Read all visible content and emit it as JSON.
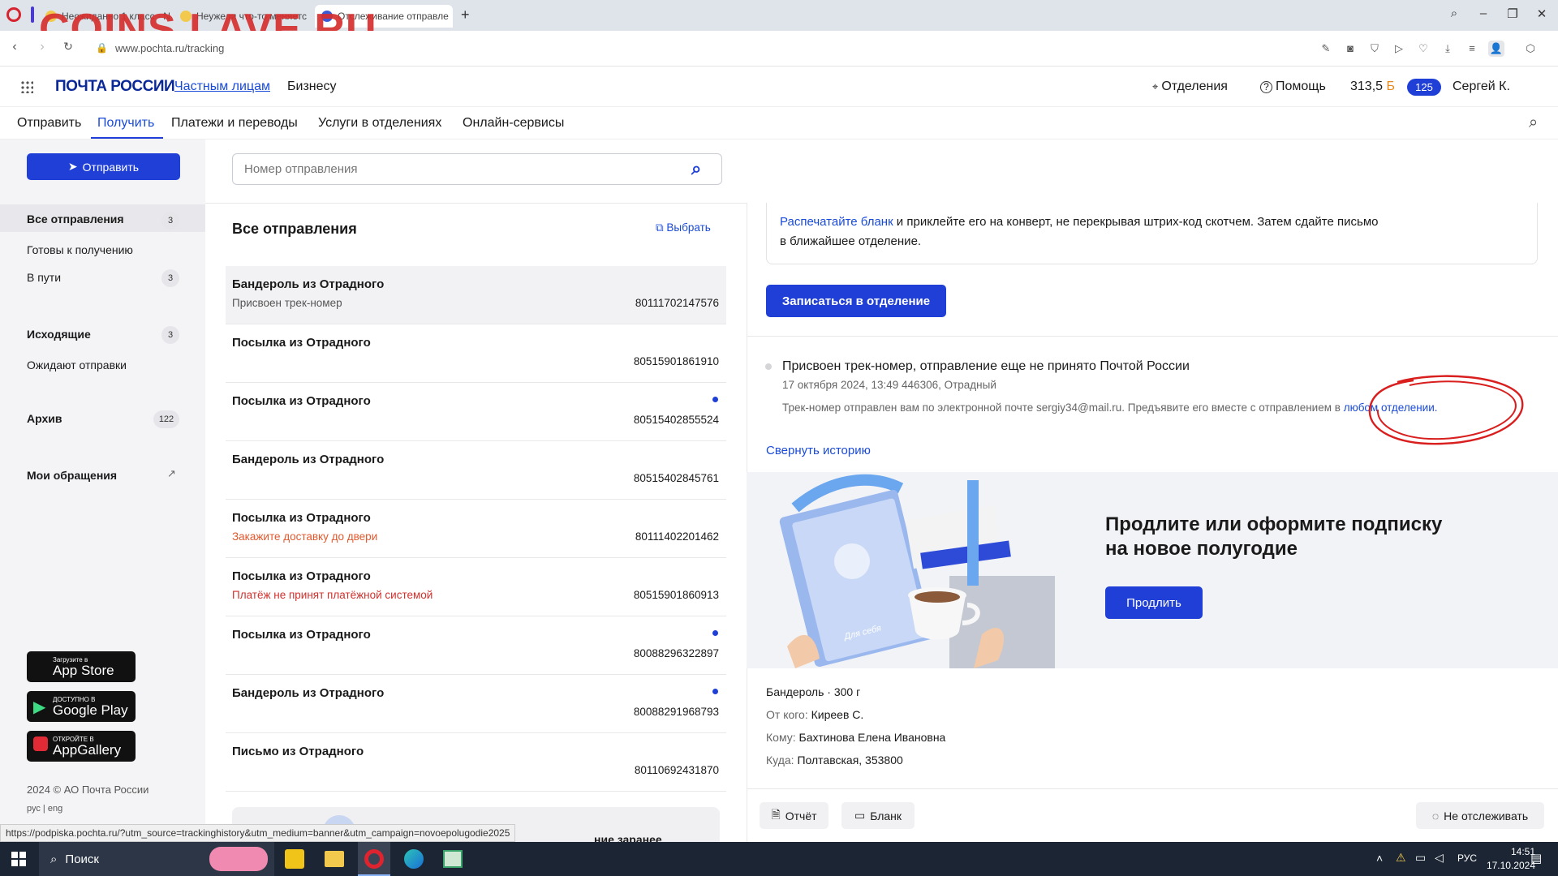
{
  "browser": {
    "tabs": [
      {
        "label": "Неожиданно 1 класс - N"
      },
      {
        "label": "Неужели что-то меняетс"
      },
      {
        "label": "Отслеживание отправле"
      }
    ],
    "url": "www.pochta.ru/tracking",
    "watermark": "COINS.LAVE.RU"
  },
  "header": {
    "logo": "ПОЧТА РОССИИ",
    "nav": [
      "Частным лицам",
      "Бизнесу"
    ],
    "offices": "Отделения",
    "help": "Помощь",
    "bonus": "313,5",
    "bonus_unit": "Б",
    "badge": "125",
    "user": "Сергей К."
  },
  "subnav": [
    "Отправить",
    "Получить",
    "Платежи и переводы",
    "Услуги в отделениях",
    "Онлайн-сервисы"
  ],
  "sidebar": {
    "send_button": "Отправить",
    "items": [
      {
        "label": "Все отправления",
        "count": "3"
      },
      {
        "label": "Готовы к получению",
        "count": ""
      },
      {
        "label": "В пути",
        "count": "3"
      },
      {
        "label": "Исходящие",
        "count": "3"
      },
      {
        "label": "Ожидают отправки",
        "count": ""
      },
      {
        "label": "Архив",
        "count": "122"
      },
      {
        "label": "Мои обращения",
        "count": ""
      }
    ],
    "stores": [
      {
        "small": "Загрузите в",
        "big": "App Store"
      },
      {
        "small": "ДОСТУПНО В",
        "big": "Google Play"
      },
      {
        "small": "ОТКРОЙТЕ В",
        "big": "AppGallery"
      }
    ],
    "copyright": "2024 © АО Почта России",
    "langs": "рус | eng"
  },
  "search": {
    "placeholder": "Номер отправления"
  },
  "list": {
    "title": "Все отправления",
    "select": "Выбрать",
    "items": [
      {
        "title": "Бандероль из Отрадного",
        "sub": "Присвоен трек-номер",
        "number": "80111702147576"
      },
      {
        "title": "Посылка из Отрадного",
        "sub": "",
        "number": "80515901861910"
      },
      {
        "title": "Посылка из Отрадного",
        "sub": "",
        "number": "80515402855524"
      },
      {
        "title": "Бандероль из Отрадного",
        "sub": "",
        "number": "80515402845761"
      },
      {
        "title": "Посылка из Отрадного",
        "sub": "Закажите доставку до двери",
        "number": "80111402201462"
      },
      {
        "title": "Посылка из Отрадного",
        "sub": "Платёж не принят платёжной системой",
        "number": "80515901860913"
      },
      {
        "title": "Посылка из Отрадного",
        "sub": "",
        "number": "80088296322897"
      },
      {
        "title": "Бандероль из Отрадного",
        "sub": "",
        "number": "80088291968793"
      },
      {
        "title": "Письмо из Отрадного",
        "sub": "",
        "number": "80110692431870"
      }
    ],
    "bottom_text": "ние заранее"
  },
  "detail": {
    "print_link": "Распечатайте бланк",
    "print_text": " и приклейте его на конверт, не перекрывая штрих-код скотчем. Затем сдайте письмо",
    "print_text2": "в ближайшее отделение.",
    "appointment_button": "Записаться в отделение",
    "event_title": "Присвоен трек-номер, отправление еще не принято Почтой России",
    "event_meta": "17 октября 2024, 13:49 446306, Отрадный",
    "event_desc": "Трек-номер отправлен вам по электронной почте sergiy34@mail.ru. Предъявите его вместе с отправлением в ",
    "event_link": "любом отделении.",
    "collapse": "Свернуть историю",
    "promo_title1": "Продлите или оформите подписку",
    "promo_title2": "на новое полугодие",
    "promo_button": "Продлить",
    "book_caption": "Для себя",
    "type": "Бандероль",
    "weight": "300 г",
    "from_label": "От кого:",
    "from": "Киреев С.",
    "to_label": "Кому:",
    "to": "Бахтинова Елена Ивановна",
    "where_label": "Куда:",
    "where": "Полтавская, 353800",
    "report": "Отчёт",
    "blank": "Бланк",
    "untrack": "Не отслеживать"
  },
  "statusbar": "https://podpiska.pochta.ru/?utm_source=trackinghistory&utm_medium=banner&utm_campaign=novoepolugodie2025",
  "taskbar": {
    "search": "Поиск",
    "lang": "РУС",
    "time": "14:51",
    "date": "17.10.2024"
  },
  "colors": {
    "brand": "#0a2896",
    "accent": "#1f3fd6",
    "warning": "#e2582d",
    "error": "#d0312d",
    "annotation": "#d91e1e"
  }
}
